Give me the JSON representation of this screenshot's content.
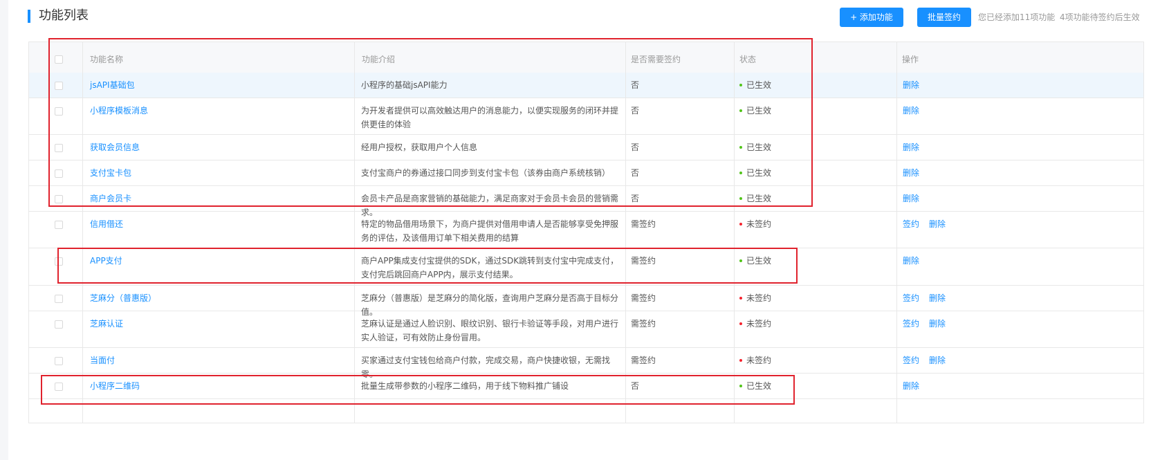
{
  "header": {
    "title": "功能列表",
    "add_button": "+ 添加功能",
    "batch_sign_button": "批量签约",
    "hint_added": "您已经添加11项功能",
    "hint_pending": "4项功能待签约后生效"
  },
  "table": {
    "columns": [
      "功能名称",
      "功能介绍",
      "是否需要签约",
      "状态",
      "操作"
    ],
    "rows": [
      {
        "name": "jsAPI基础包",
        "desc": "小程序的基础jsAPI能力",
        "sign": "否",
        "status": "已生效",
        "status_color": "#52c41a",
        "ops": [
          "删除"
        ]
      },
      {
        "name": "小程序模板消息",
        "desc": "为开发者提供可以高效触达用户的消息能力，以便实现服务的闭环并提供更佳的体验",
        "sign": "否",
        "status": "已生效",
        "status_color": "#52c41a",
        "ops": [
          "删除"
        ]
      },
      {
        "name": "获取会员信息",
        "desc": "经用户授权，获取用户个人信息",
        "sign": "否",
        "status": "已生效",
        "status_color": "#52c41a",
        "ops": [
          "删除"
        ]
      },
      {
        "name": "支付宝卡包",
        "desc": "支付宝商户的券通过接口同步到支付宝卡包（该券由商户系统核销）",
        "sign": "否",
        "status": "已生效",
        "status_color": "#52c41a",
        "ops": [
          "删除"
        ]
      },
      {
        "name": "商户会员卡",
        "desc": "会员卡产品是商家营销的基础能力，满足商家对于会员卡会员的营销需求。",
        "sign": "否",
        "status": "已生效",
        "status_color": "#52c41a",
        "ops": [
          "删除"
        ]
      },
      {
        "name": "信用借还",
        "desc": "特定的物品借用场景下，为商户提供对借用申请人是否能够享受免押服务的评估，及该借用订单下相关费用的结算",
        "sign": "需签约",
        "status": "未签约",
        "status_color": "#f5222d",
        "ops": [
          "签约",
          "删除"
        ]
      },
      {
        "name": "APP支付",
        "desc": "商户APP集成支付宝提供的SDK，通过SDK跳转到支付宝中完成支付，支付完后跳回商户APP内，展示支付结果。",
        "sign": "需签约",
        "status": "已生效",
        "status_color": "#52c41a",
        "ops": [
          "删除"
        ]
      },
      {
        "name": "芝麻分（普惠版）",
        "desc": "芝麻分（普惠版）是芝麻分的简化版，查询用户芝麻分是否高于目标分值。",
        "sign": "需签约",
        "status": "未签约",
        "status_color": "#f5222d",
        "ops": [
          "签约",
          "删除"
        ]
      },
      {
        "name": "芝麻认证",
        "desc": "芝麻认证是通过人脸识别、眼纹识别、银行卡验证等手段，对用户进行实人验证，可有效防止身份冒用。",
        "sign": "需签约",
        "status": "未签约",
        "status_color": "#f5222d",
        "ops": [
          "签约",
          "删除"
        ]
      },
      {
        "name": "当面付",
        "desc": "买家通过支付宝钱包给商户付款，完成交易，商户快捷收银，无需找零。",
        "sign": "需签约",
        "status": "未签约",
        "status_color": "#f5222d",
        "ops": [
          "签约",
          "删除"
        ]
      },
      {
        "name": "小程序二维码",
        "desc": "批量生成带参数的小程序二维码，用于线下物料推广铺设",
        "sign": "否",
        "status": "已生效",
        "status_color": "#52c41a",
        "ops": [
          "删除"
        ]
      }
    ]
  },
  "colors": {
    "accent": "#1890ff",
    "status_active": "#52c41a",
    "status_unsigned": "#f5222d",
    "annotation_box": "#e0222d"
  }
}
